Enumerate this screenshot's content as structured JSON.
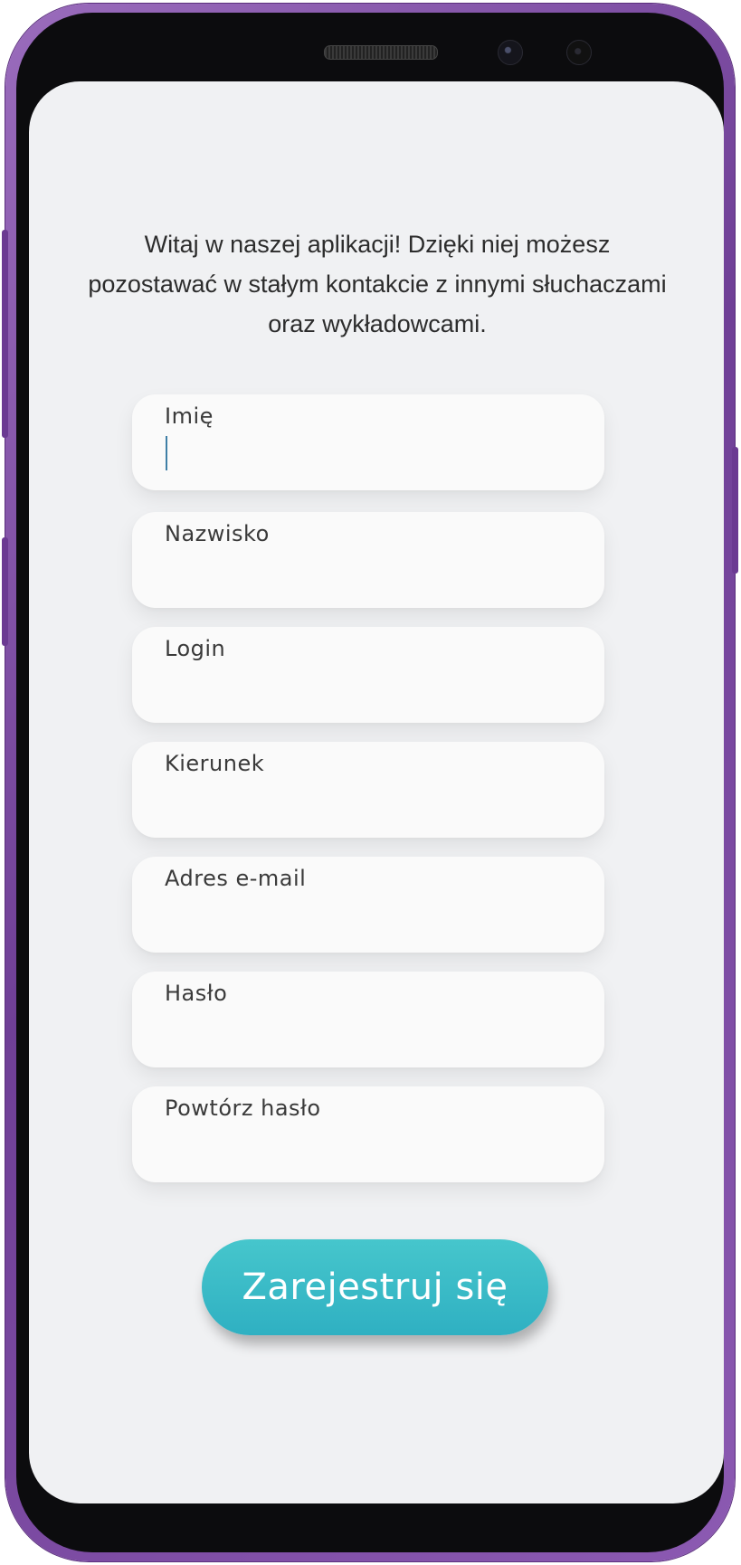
{
  "intro_text": "Witaj w naszej aplikacji! Dzięki niej możesz pozostawać w stałym kontakcie z innymi słuchaczami oraz wykładowcami.",
  "form": {
    "fields": [
      {
        "label": "Imię",
        "value": ""
      },
      {
        "label": "Nazwisko",
        "value": ""
      },
      {
        "label": "Login",
        "value": ""
      },
      {
        "label": "Kierunek",
        "value": ""
      },
      {
        "label": "Adres e-mail",
        "value": ""
      },
      {
        "label": "Hasło",
        "value": ""
      },
      {
        "label": "Powtórz hasło",
        "value": ""
      }
    ],
    "submit_label": "Zarejestruj się"
  },
  "colors": {
    "accent": "#35b8c4",
    "screen_background": "#f0f1f3",
    "frame": "#7a4aa3"
  }
}
